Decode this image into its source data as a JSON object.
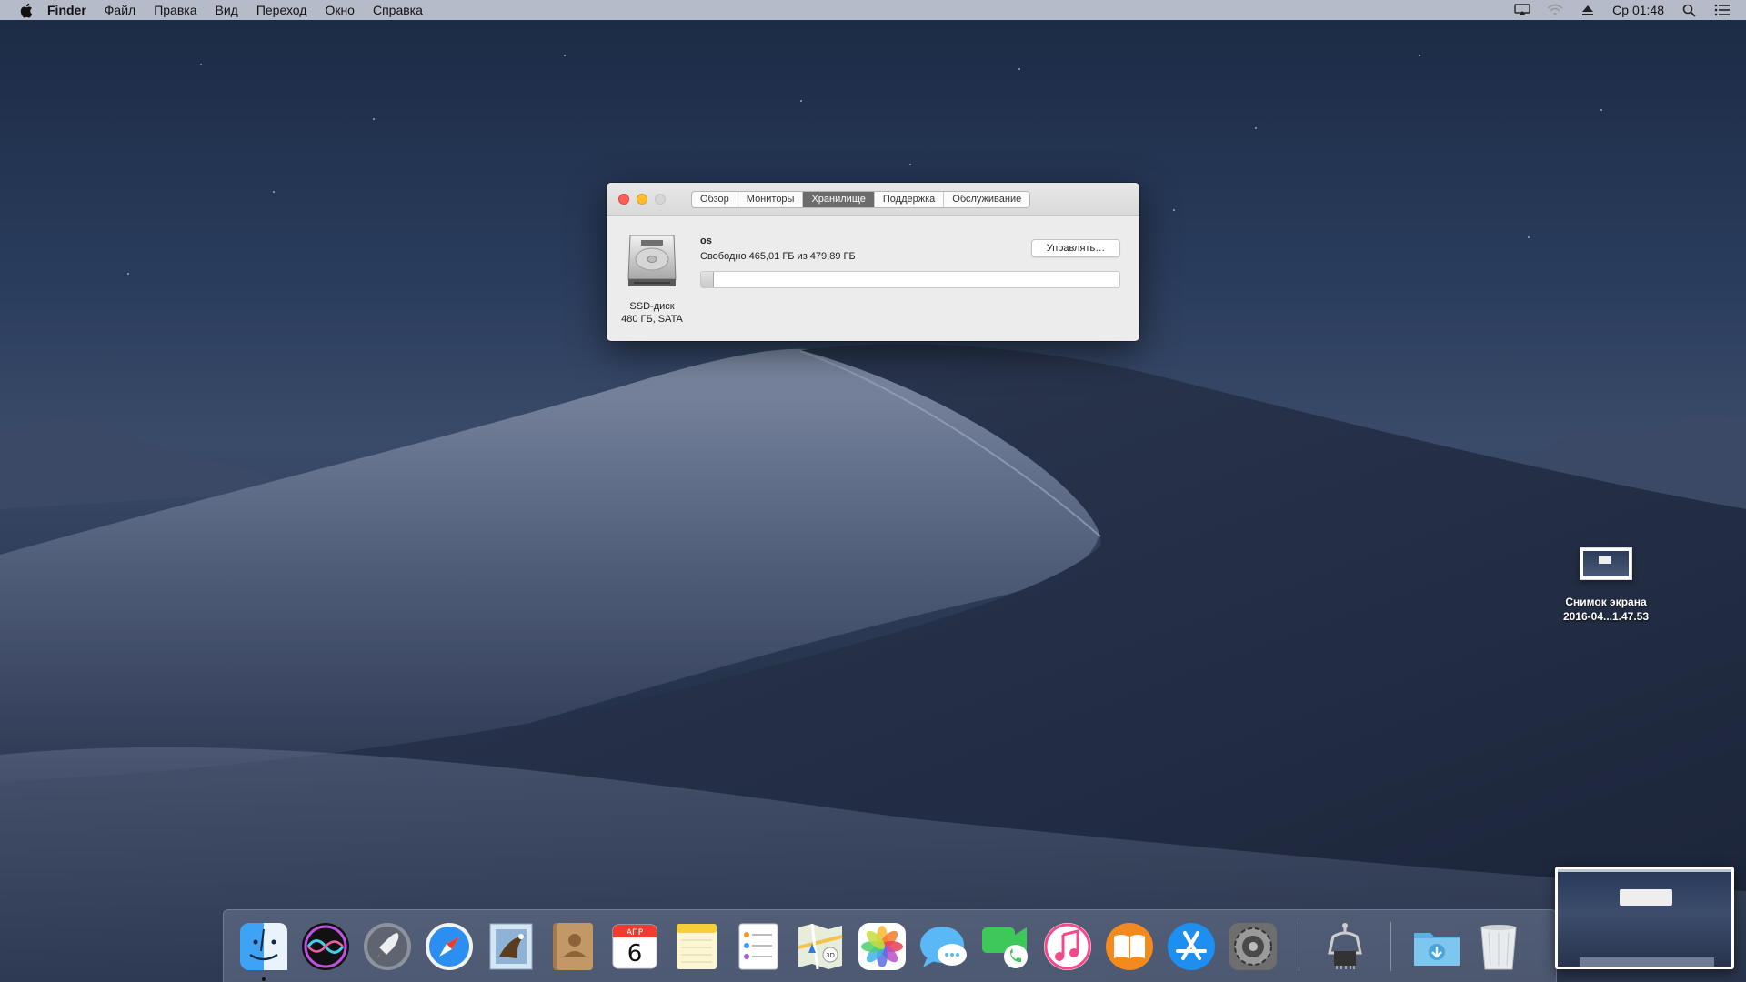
{
  "menubar": {
    "app_name": "Finder",
    "items": [
      "Файл",
      "Правка",
      "Вид",
      "Переход",
      "Окно",
      "Справка"
    ],
    "clock": "Ср 01:48",
    "status_icons": [
      "airplay-icon",
      "wifi-icon",
      "eject-icon",
      "spotlight-search-icon",
      "notification-center-icon"
    ]
  },
  "window": {
    "tabs": [
      "Обзор",
      "Мониторы",
      "Хранилище",
      "Поддержка",
      "Обслуживание"
    ],
    "active_tab": "Хранилище",
    "disk_type": "SSD-диск",
    "disk_spec": "480 ГБ, SATA",
    "volume_name": "os",
    "free_text": "Свободно 465,01 ГБ из 479,89 ГБ",
    "used_fraction": 0.031,
    "manage_button": "Управлять…"
  },
  "desktop_icon": {
    "line1": "Снимок экрана",
    "line2": "2016-04...1.47.53"
  },
  "dock": {
    "apps": [
      "finder-icon",
      "siri-icon",
      "launchpad-icon",
      "safari-icon",
      "mail-icon",
      "contacts-icon",
      "calendar-icon",
      "notes-icon",
      "reminders-icon",
      "maps-icon",
      "photos-icon",
      "messages-icon",
      "facetime-icon",
      "itunes-icon",
      "ibooks-icon",
      "app-store-icon",
      "system-preferences-icon",
      "system-information-icon",
      "downloads-icon",
      "trash-icon"
    ],
    "calendar_month": "АПР",
    "calendar_day": "6"
  }
}
